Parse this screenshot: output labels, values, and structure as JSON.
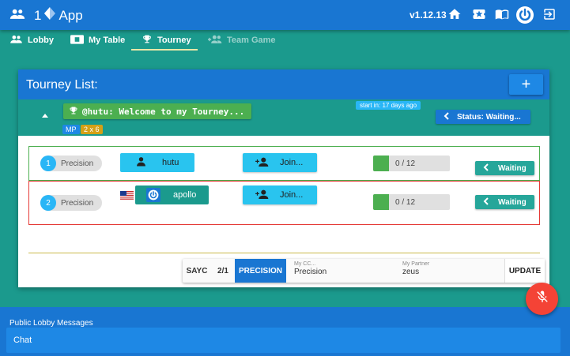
{
  "app": {
    "title_prefix": "1",
    "title_suffix": "App",
    "version": "v1.12.13"
  },
  "tabs": [
    {
      "label": "Lobby"
    },
    {
      "label": "My Table"
    },
    {
      "label": "Tourney"
    },
    {
      "label": "Team Game"
    }
  ],
  "card": {
    "title": "Tourney List:",
    "add_label": "+",
    "tourney": {
      "name": "@hutu: Welcome to my Tourney...",
      "badge_mp": "MP",
      "badge_format": "2 x 6",
      "start_in": "start in: 17 days ago",
      "status": "Status: Waiting..."
    },
    "rows": [
      {
        "num": "1",
        "system": "Precision",
        "player": "hutu",
        "join": "Join...",
        "progress": "0 / 12",
        "progress_fraction": 0.2,
        "state": "Waiting"
      },
      {
        "num": "2",
        "system": "Precision",
        "player": "apollo",
        "join": "Join...",
        "progress": "0 / 12",
        "progress_fraction": 0.2,
        "state": "Waiting"
      }
    ],
    "settings": {
      "segments": [
        "SAYC",
        "2/1",
        "PRECISION"
      ],
      "my_cc_label": "My CC...",
      "my_cc_value": "Precision",
      "partner_label": "My Partner",
      "partner_value": "zeus",
      "update": "UPDATE"
    }
  },
  "lobby_messages": "Public Lobby Messages",
  "chat_placeholder": "Chat",
  "colors": {
    "primary": "#1976d2",
    "teal": "#1b9a8d",
    "accent": "#29c4ef",
    "success": "#4caf50",
    "danger": "#f44336"
  }
}
